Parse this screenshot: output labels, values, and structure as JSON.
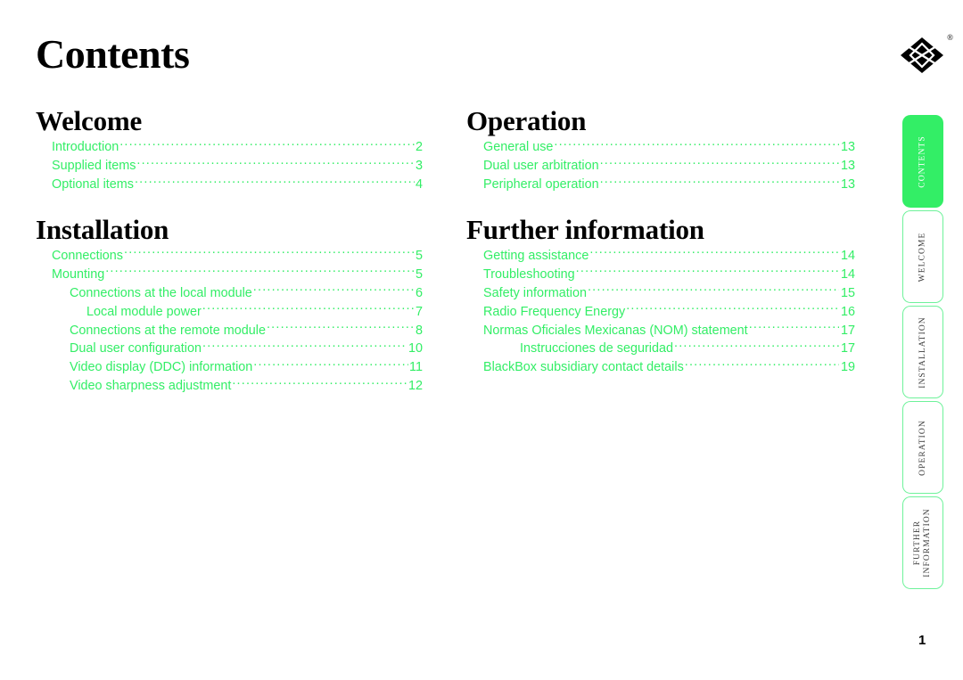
{
  "document": {
    "page_title": "Contents",
    "page_number": "1"
  },
  "brand": {
    "logo_name": "black-box-diamond-logo",
    "registered_mark": "®",
    "accent_color": "#33ee66",
    "text_color": "#000000"
  },
  "columns": {
    "left": [
      {
        "heading": "Welcome",
        "entries": [
          {
            "label": "Introduction",
            "page": "2",
            "level": 1
          },
          {
            "label": "Supplied items",
            "page": "3",
            "level": 1
          },
          {
            "label": "Optional items",
            "page": "4",
            "level": 1
          }
        ]
      },
      {
        "heading": "Installation",
        "entries": [
          {
            "label": "Connections",
            "page": "5",
            "level": 1
          },
          {
            "label": "Mounting",
            "page": "5",
            "level": 1
          },
          {
            "label": "Connections at the local module",
            "page": "6",
            "level": 2
          },
          {
            "label": "Local module power",
            "page": "7",
            "level": 3
          },
          {
            "label": "Connections at the remote module",
            "page": "8",
            "level": 2
          },
          {
            "label": "Dual user configuration",
            "page": "10",
            "level": 2
          },
          {
            "label": "Video display (DDC) information",
            "page": "11",
            "level": 2
          },
          {
            "label": "Video sharpness adjustment",
            "page": "12",
            "level": 2
          }
        ]
      }
    ],
    "right": [
      {
        "heading": "Operation",
        "entries": [
          {
            "label": "General use",
            "page": "13",
            "level": 1
          },
          {
            "label": "Dual user arbitration",
            "page": "13",
            "level": 1
          },
          {
            "label": "Peripheral operation",
            "page": "13",
            "level": 1
          }
        ]
      },
      {
        "heading": "Further information",
        "entries": [
          {
            "label": "Getting assistance",
            "page": "14",
            "level": 1
          },
          {
            "label": "Troubleshooting",
            "page": "14",
            "level": 1
          },
          {
            "label": "Safety information",
            "page": "15",
            "level": 1
          },
          {
            "label": "Radio Frequency Energy",
            "page": "16",
            "level": 1
          },
          {
            "label": "Normas Oficiales Mexicanas (NOM) statement",
            "page": "17",
            "level": 1
          },
          {
            "label": "Instrucciones de seguridad",
            "page": "17",
            "level": 3
          },
          {
            "label": "BlackBox subsidiary contact details",
            "page": "19",
            "level": 1
          }
        ]
      }
    ]
  },
  "side_tabs": [
    {
      "label": "CONTENTS",
      "active": true
    },
    {
      "label": "WELCOME",
      "active": false
    },
    {
      "label": "INSTALLATION",
      "active": false
    },
    {
      "label": "OPERATION",
      "active": false
    },
    {
      "label": "FURTHER\nINFORMATION",
      "active": false
    }
  ]
}
